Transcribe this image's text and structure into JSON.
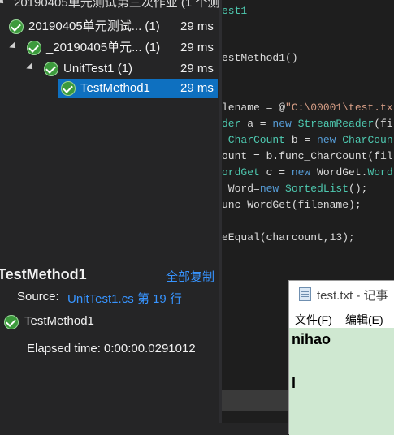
{
  "test_explorer": {
    "tree": [
      {
        "label": "20190405单元测试第三次作业 (1 个测",
        "duration": ""
      },
      {
        "label": "20190405单元测试... (1)",
        "duration": "29 ms"
      },
      {
        "label": "_20190405单元... (1)",
        "duration": "29 ms"
      },
      {
        "label": "UnitTest1 (1)",
        "duration": "29 ms"
      },
      {
        "label": "TestMethod1",
        "duration": "29 ms"
      }
    ],
    "details": {
      "title": "TestMethod1",
      "copy_all": "全部复制",
      "source_label": "Source:",
      "source_link": "UnitTest1.cs 第 19 行",
      "test_name": "TestMethod1",
      "elapsed": "Elapsed time: 0:00:00.0291012"
    }
  },
  "editor": {
    "lines": {
      "l0": "est1",
      "l1": "estMethod1()",
      "l2a": "lename = @",
      "l2b": "\"C:\\00001\\test.tx",
      "l3a": "der",
      "l3b": " a = ",
      "l3c": "new",
      "l3d": " StreamReader",
      "l3e": "(fil",
      "l4a": " CharCount",
      "l4b": " b = ",
      "l4c": "new",
      "l4d": " CharCoun",
      "l5": "ount = b.func_CharCount(fil",
      "l6a": "ordGet",
      "l6b": " c = ",
      "l6c": "new",
      "l6d": " WordGet.",
      "l6e": "Word",
      "l7a": " Word=",
      "l7b": "new",
      "l7c": " SortedList",
      "l7d": "();",
      "l8": "unc_WordGet(filename);",
      "l9": "eEqual(charcount,13);"
    }
  },
  "notepad": {
    "title": "test.txt - 记事",
    "menu": [
      "文件(F)",
      "编辑(E)"
    ],
    "text_lines": [
      "nihao",
      "l"
    ]
  },
  "colors": {
    "pass_green": "#3c9a3c",
    "selection_blue": "#0e70c0",
    "link_blue": "#3794ff",
    "notepad_bg": "#cfe8d1"
  }
}
